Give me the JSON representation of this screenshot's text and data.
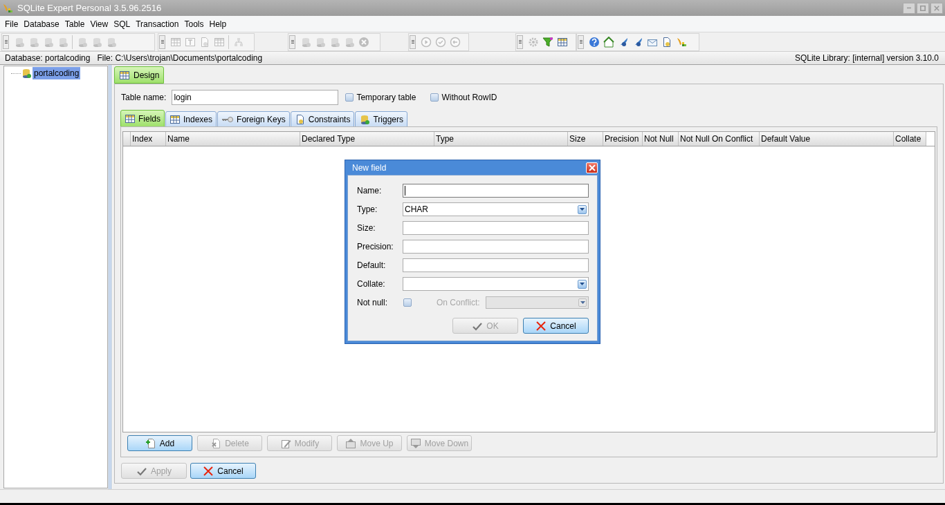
{
  "window": {
    "title": "SQLite Expert Personal 3.5.96.2516"
  },
  "menu": [
    "File",
    "Database",
    "Table",
    "View",
    "SQL",
    "Transaction",
    "Tools",
    "Help"
  ],
  "toolbar": {
    "groups": [
      {
        "items": [
          {
            "kind": "database",
            "disabled": true
          },
          {
            "kind": "database",
            "disabled": true
          },
          {
            "kind": "database",
            "disabled": true
          },
          {
            "kind": "database",
            "disabled": true
          },
          {
            "kind": "separator"
          },
          {
            "kind": "database",
            "disabled": true
          },
          {
            "kind": "database",
            "disabled": true
          },
          {
            "kind": "database",
            "disabled": true
          }
        ]
      },
      {
        "items": [
          {
            "kind": "table",
            "disabled": true
          },
          {
            "kind": "text",
            "disabled": true
          },
          {
            "kind": "document",
            "disabled": true
          },
          {
            "kind": "table",
            "disabled": true
          },
          {
            "kind": "separator"
          },
          {
            "kind": "tree",
            "disabled": true
          }
        ]
      },
      {
        "items": [
          {
            "kind": "database",
            "disabled": true
          },
          {
            "kind": "database",
            "disabled": true
          },
          {
            "kind": "database",
            "disabled": true
          },
          {
            "kind": "database",
            "disabled": true
          },
          {
            "kind": "stop",
            "disabled": true
          }
        ]
      },
      {
        "items": [
          {
            "kind": "play",
            "disabled": true
          },
          {
            "kind": "check",
            "disabled": true
          },
          {
            "kind": "back",
            "disabled": true
          }
        ]
      },
      {
        "items": [
          {
            "kind": "gear",
            "disabled": true
          },
          {
            "kind": "filter",
            "disabled": false
          },
          {
            "kind": "table",
            "disabled": false
          }
        ]
      },
      {
        "items": [
          {
            "kind": "help",
            "disabled": false
          },
          {
            "kind": "home",
            "disabled": false
          },
          {
            "kind": "feather",
            "disabled": false
          },
          {
            "kind": "feather",
            "disabled": false
          },
          {
            "kind": "mail",
            "disabled": false
          },
          {
            "kind": "document",
            "disabled": false
          },
          {
            "kind": "logo",
            "disabled": false
          }
        ]
      }
    ]
  },
  "info_bar": {
    "database": "Database: portalcoding",
    "file": "File: C:\\Users\\trojan\\Documents\\portalcoding",
    "library": "SQLite Library: [internal] version 3.10.0"
  },
  "sidebar": {
    "items": [
      {
        "label": "portalcoding",
        "selected": true
      }
    ]
  },
  "editor_tabs": [
    {
      "label": "Design",
      "selected": true
    }
  ],
  "table_name": {
    "label": "Table name:",
    "value": "login"
  },
  "options": [
    {
      "label": "Temporary table",
      "checked": false
    },
    {
      "label": "Without RowID",
      "checked": false
    }
  ],
  "design_tabs": [
    {
      "label": "Fields",
      "kind": "fields",
      "selected": true
    },
    {
      "label": "Indexes",
      "kind": "indexes",
      "selected": false
    },
    {
      "label": "Foreign Keys",
      "kind": "key",
      "selected": false
    },
    {
      "label": "Constraints",
      "kind": "constraints",
      "selected": false
    },
    {
      "label": "Triggers",
      "kind": "triggers",
      "selected": false
    }
  ],
  "grid": {
    "columns": [
      "Index",
      "Name",
      "Declared Type",
      "Type",
      "Size",
      "Precision",
      "Not Null",
      "Not Null On Conflict",
      "Default Value",
      "Collate"
    ]
  },
  "field_buttons": [
    {
      "label": "Add",
      "kind": "add",
      "disabled": false,
      "default": true
    },
    {
      "label": "Delete",
      "kind": "delete",
      "disabled": true,
      "default": false
    },
    {
      "label": "Modify",
      "kind": "modify",
      "disabled": true,
      "default": false
    },
    {
      "label": "Move Up",
      "kind": "up",
      "disabled": true,
      "default": false
    },
    {
      "label": "Move Down",
      "kind": "down",
      "disabled": true,
      "default": false
    }
  ],
  "bottom_buttons": [
    {
      "label": "Apply",
      "kind": "ok",
      "disabled": true,
      "default": false
    },
    {
      "label": "Cancel",
      "kind": "cancel",
      "disabled": false,
      "default": true
    }
  ],
  "dialog": {
    "title": "New field",
    "fields": [
      {
        "label": "Name:",
        "kind": "text",
        "focused": true
      },
      {
        "label": "Type:",
        "kind": "combo",
        "value": "CHAR",
        "focused": false
      },
      {
        "label": "Size:",
        "kind": "text",
        "focused": false
      },
      {
        "label": "Precision:",
        "kind": "text",
        "focused": false
      },
      {
        "label": "Default:",
        "kind": "text",
        "focused": false
      },
      {
        "label": "Collate:",
        "kind": "combo",
        "focused": false
      }
    ],
    "not_null": {
      "label": "Not null:",
      "checked": false
    },
    "on_conflict": {
      "label": "On Conflict:",
      "disabled": true
    },
    "buttons": [
      {
        "label": "OK",
        "kind": "ok",
        "disabled": true,
        "default": false
      },
      {
        "label": "Cancel",
        "kind": "cancel",
        "disabled": false,
        "default": true
      }
    ]
  }
}
